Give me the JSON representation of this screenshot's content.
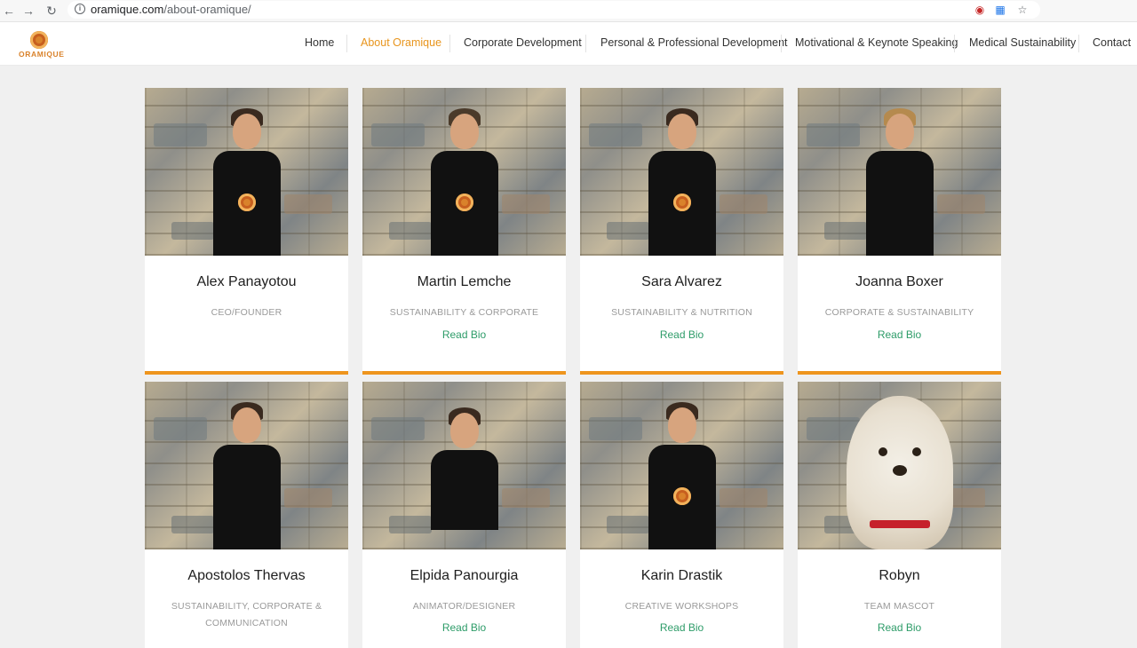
{
  "browser": {
    "back_icon": "arrow-left-icon",
    "forward_icon": "arrow-right-icon",
    "reload_icon": "reload-icon",
    "url_host": "oramique.com",
    "url_path": "/about-oramique/"
  },
  "header": {
    "logo_text": "ORAMIQUE",
    "menu": [
      {
        "label": "Home"
      },
      {
        "label": "About Oramique",
        "active": true
      },
      {
        "label": "Corporate Development"
      },
      {
        "label": "Personal & Professional Development"
      },
      {
        "label": "Motivational & Keynote Speaking"
      },
      {
        "label": "Medical Sustainability"
      },
      {
        "label": "Contact"
      }
    ],
    "active_color": "#e8951d"
  },
  "team": [
    {
      "name": "Alex Panayotou",
      "role": "CEO/FOUNDER",
      "link": ""
    },
    {
      "name": "Martin Lemche",
      "role": "SUSTAINABILITY & CORPORATE",
      "link": "Read Bio"
    },
    {
      "name": "Sara Alvarez",
      "role": "SUSTAINABILITY & NUTRITION",
      "link": "Read Bio"
    },
    {
      "name": "Joanna Boxer",
      "role": "CORPORATE & SUSTAINABILITY",
      "link": "Read Bio"
    },
    {
      "name": "Apostolos Thervas",
      "role": "SUSTAINABILITY, CORPORATE & COMMUNICATION",
      "link": "Read Bio"
    },
    {
      "name": "Elpida Panourgia",
      "role": "ANIMATOR/DESIGNER",
      "link": "Read Bio"
    },
    {
      "name": "Karin Drastik",
      "role": "CREATIVE WORKSHOPS",
      "link": "Read Bio"
    },
    {
      "name": "Robyn",
      "role": "TEAM MASCOT",
      "link": "Read Bio"
    }
  ],
  "colors": {
    "accent_orange": "#ee951e",
    "link_green": "#2e9c69"
  }
}
